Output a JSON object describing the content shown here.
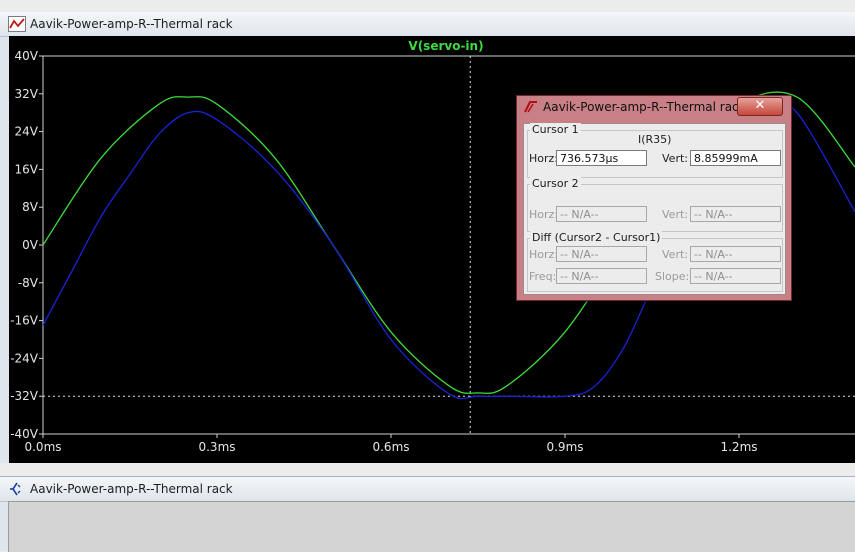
{
  "plot_window": {
    "title": "Aavik-Power-amp-R--Thermal rack",
    "trace_label": "V(servo-in)",
    "y_ticks": [
      "40V",
      "32V",
      "24V",
      "16V",
      "8V",
      "0V",
      "-8V",
      "-16V",
      "-24V",
      "-32V",
      "-40V"
    ],
    "x_ticks": [
      "0.0ms",
      "0.3ms",
      "0.6ms",
      "0.9ms",
      "1.2ms"
    ],
    "colors": {
      "background": "#000000",
      "green_trace": "#3cdc3c",
      "blue_trace": "#1a22d6",
      "cursor": "#e0e0e0",
      "text": "#e6e6e6"
    }
  },
  "chart_data": {
    "type": "line",
    "xlabel": "",
    "ylabel": "",
    "xlim": [
      0,
      1.4
    ],
    "ylim": [
      -40,
      40
    ],
    "series": [
      {
        "name": "V(servo-in)",
        "x": [
          0.0,
          0.1,
          0.2,
          0.25,
          0.3,
          0.4,
          0.5,
          0.6,
          0.7,
          0.75,
          0.8,
          0.9,
          1.0,
          1.1,
          1.2,
          1.3,
          1.4
        ],
        "values": [
          0,
          18.4,
          29.8,
          31.3,
          29.8,
          18.4,
          0,
          -18.4,
          -29.8,
          -31.3,
          -29.8,
          -18.4,
          0,
          18.4,
          29.8,
          31.3,
          16.5
        ]
      },
      {
        "name": "I(R35)",
        "x": [
          0.0,
          0.05,
          0.1,
          0.15,
          0.2,
          0.25,
          0.3,
          0.4,
          0.5,
          0.6,
          0.7,
          0.75,
          0.8,
          0.9,
          0.95,
          1.0,
          1.05,
          1.1,
          1.2,
          1.25,
          1.3,
          1.4
        ],
        "values": [
          -17,
          -5.5,
          6,
          15,
          23.5,
          28,
          26.5,
          16,
          0,
          -20,
          -31.5,
          -32,
          -32,
          -32,
          -30,
          -22,
          -9,
          3,
          22,
          28.5,
          28,
          7
        ]
      }
    ],
    "cursor": {
      "x": 0.7366,
      "y": -32
    }
  },
  "cursor_dialog": {
    "title": "Aavik-Power-amp-R--Thermal rack",
    "close_label": "✕",
    "cursor1": {
      "label": "Cursor 1",
      "trace": "I(R35)",
      "horz_label": "Horz:",
      "horz_value": "736.573µs",
      "vert_label": "Vert:",
      "vert_value": "8.85999mA"
    },
    "cursor2": {
      "label": "Cursor 2",
      "horz_label": "Horz:",
      "horz_value": "-- N/A--",
      "vert_label": "Vert:",
      "vert_value": "-- N/A--"
    },
    "diff": {
      "label": "Diff (Cursor2 - Cursor1)",
      "horz_label": "Horz:",
      "horz_value": "-- N/A--",
      "vert_label": "Vert:",
      "vert_value": "-- N/A--",
      "freq_label": "Freq:",
      "freq_value": "-- N/A--",
      "slope_label": "Slope:",
      "slope_value": "-- N/A--"
    }
  },
  "bottom_window": {
    "title": "Aavik-Power-amp-R--Thermal rack"
  }
}
